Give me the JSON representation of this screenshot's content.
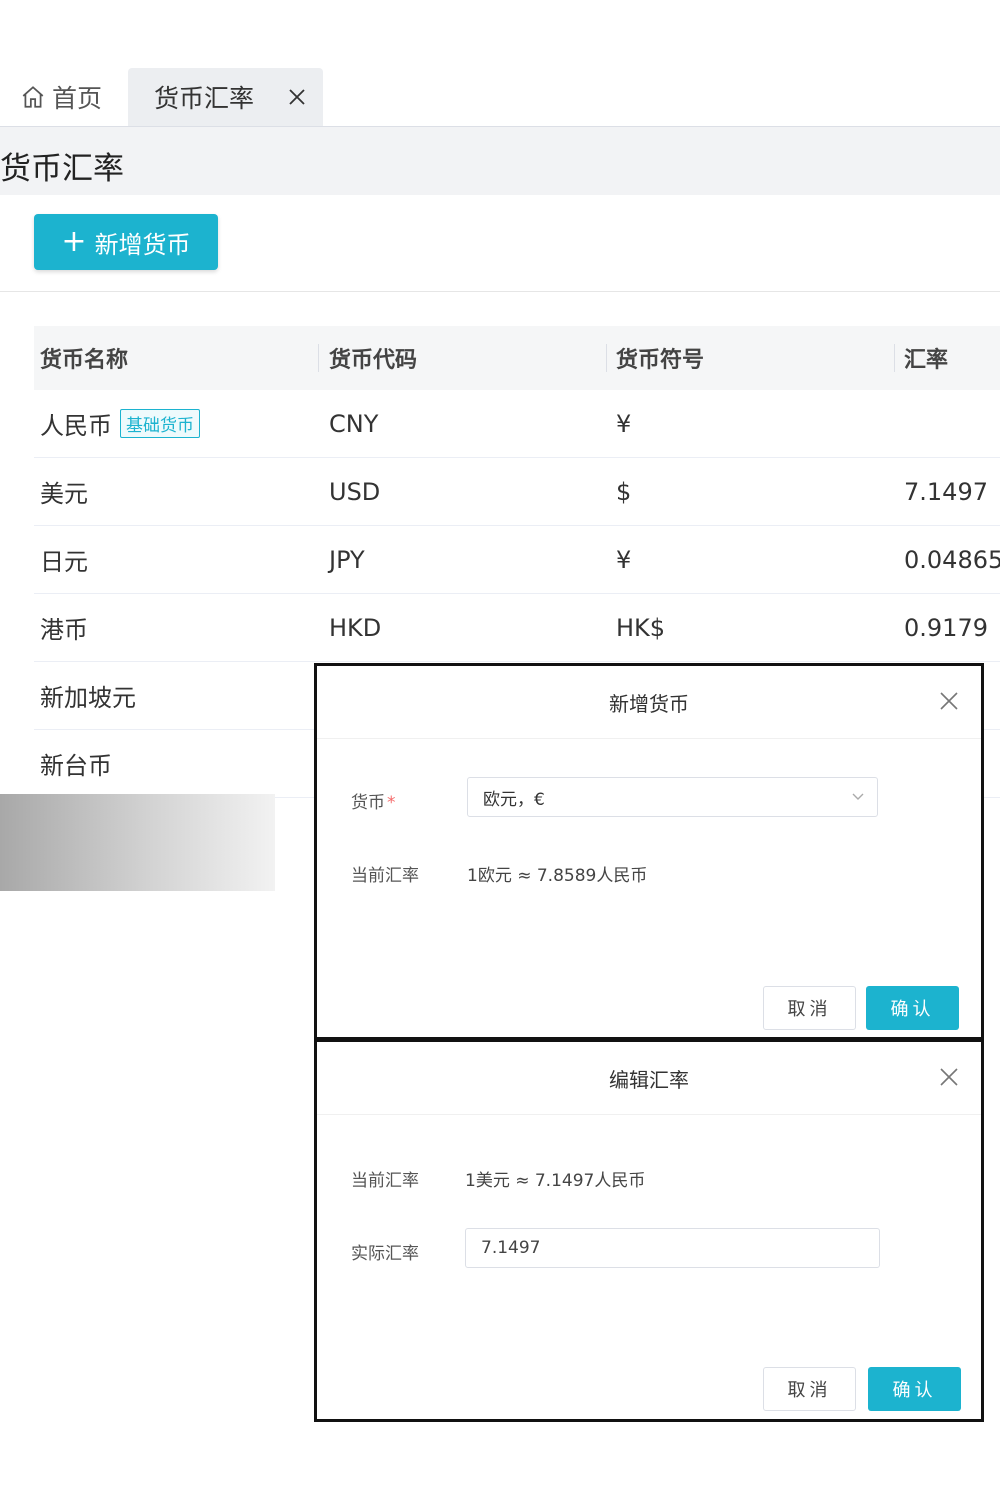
{
  "tabs": [
    {
      "label": "首页"
    },
    {
      "label": "货币汇率"
    }
  ],
  "page_title": "货币汇率",
  "add_button_label": "新增货币",
  "table": {
    "headers": [
      "货币名称",
      "货币代码",
      "货币符号",
      "汇率"
    ],
    "rows": [
      {
        "name": "人民币",
        "badge": "基础货币",
        "code": "CNY",
        "symbol": "¥",
        "rate": ""
      },
      {
        "name": "美元",
        "code": "USD",
        "symbol": "$",
        "rate": "7.1497"
      },
      {
        "name": "日元",
        "code": "JPY",
        "symbol": "¥",
        "rate": "0.04865"
      },
      {
        "name": "港币",
        "code": "HKD",
        "symbol": "HK$",
        "rate": "0.9179"
      },
      {
        "name": "新加坡元",
        "code": "",
        "symbol": "",
        "rate": ""
      },
      {
        "name": "新台币",
        "code": "",
        "symbol": "",
        "rate": ""
      }
    ]
  },
  "add_dialog": {
    "title": "新增货币",
    "currency_label": "货币",
    "required_mark": "*",
    "currency_value": "欧元，€",
    "current_rate_label": "当前汇率",
    "current_rate_text": "1欧元 ≈ 7.8589人民币",
    "cancel_label": "取消",
    "ok_label": "确认"
  },
  "edit_dialog": {
    "title": "编辑汇率",
    "current_rate_label": "当前汇率",
    "current_rate_text": "1美元 ≈ 7.1497人民币",
    "actual_rate_label": "实际汇率",
    "actual_rate_value": "7.1497",
    "cancel_label": "取消",
    "ok_label": "确认"
  },
  "colors": {
    "accent": "#1cb3cf",
    "required": "#f56c6c"
  }
}
